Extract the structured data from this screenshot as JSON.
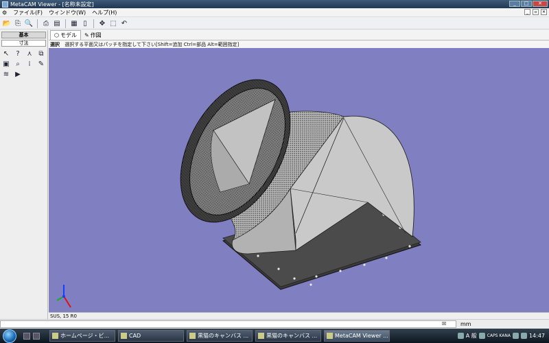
{
  "window": {
    "title": "MetaCAM Viewer - [名称未設定]"
  },
  "menu": {
    "items": [
      "ファイル(F)",
      "ウィンドウ(W)",
      "ヘルプ(H)"
    ]
  },
  "left_panel": {
    "tab_basic": "基本",
    "tab_dimension": "寸法"
  },
  "mode_tabs": {
    "model": "モデル",
    "drawing": "作図"
  },
  "hint": {
    "mode": "選択",
    "text": "選択する平面又はパッチを指定して下さい[Shift=追加 Ctrl=部品 Alt=範囲指定]"
  },
  "status": {
    "material": "SUS, 15 R0"
  },
  "command": {
    "unit": "mm",
    "close": "☒"
  },
  "taskbar": {
    "tasks": [
      {
        "label": "ホームページ・ビ..."
      },
      {
        "label": "CAD"
      },
      {
        "label": "黒猫のキャンバス ..."
      },
      {
        "label": "黒猫のキャンバス ..."
      },
      {
        "label": "MetaCAM Viewer ..."
      }
    ],
    "ime_mode": "A 般",
    "caps": "CAPS KANA",
    "clock": "14:47"
  },
  "colors": {
    "viewport_bg": "#7f7fc2",
    "model_fill": "#c8c8c8",
    "flange": "#3a3a3a"
  }
}
